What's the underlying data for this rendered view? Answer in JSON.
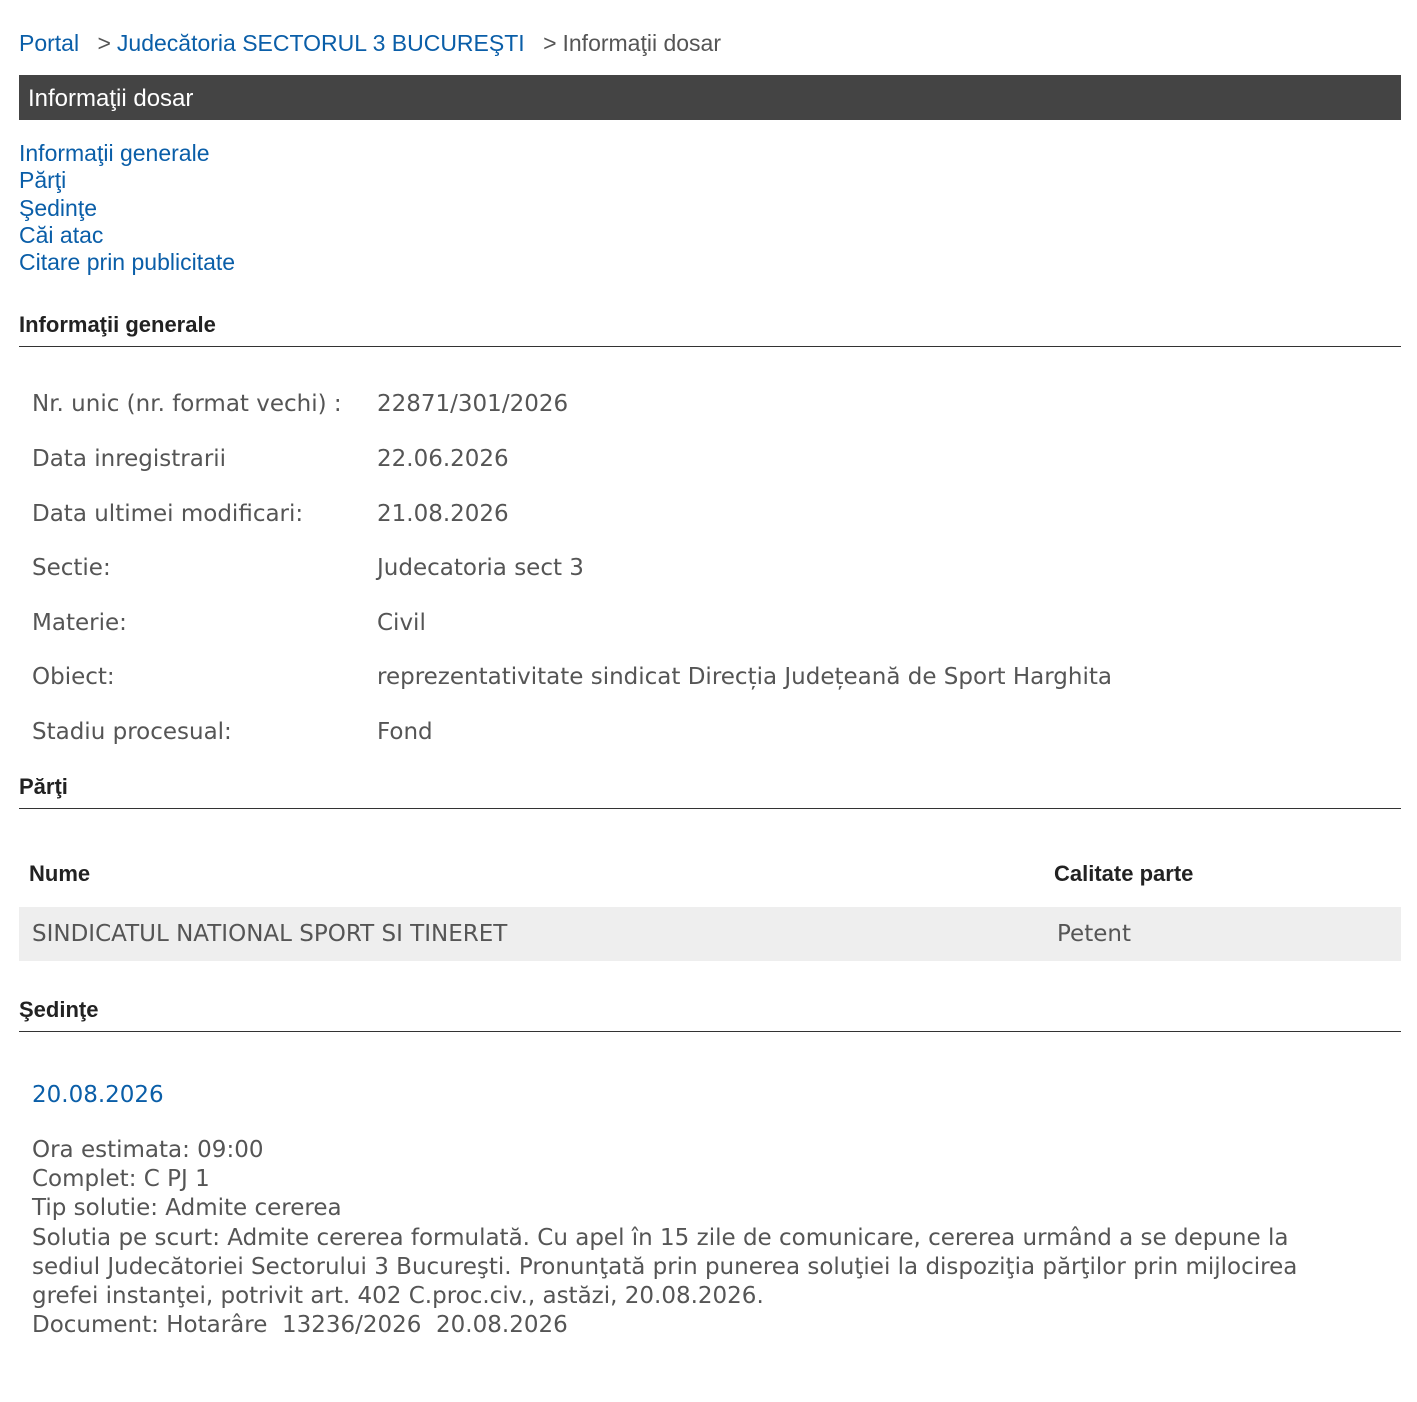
{
  "breadcrumb": {
    "portal": "Portal",
    "court": "Judecătoria SECTORUL 3 BUCUREŞTI",
    "current": "Informaţii dosar",
    "separator": ">"
  },
  "title": "Informaţii dosar",
  "toc": [
    "Informaţii generale",
    "Părţi",
    "Şedinţe",
    "Căi atac",
    "Citare prin publicitate"
  ],
  "general": {
    "heading": "Informaţii generale",
    "rows": [
      {
        "label": "Nr. unic (nr. format vechi) :",
        "value": "22871/301/2026"
      },
      {
        "label": "Data inregistrarii",
        "value": "22.06.2026"
      },
      {
        "label": "Data ultimei modificari:",
        "value": "21.08.2026"
      },
      {
        "label": "Sectie:",
        "value": "Judecatoria sect 3"
      },
      {
        "label": "Materie:",
        "value": "Civil"
      },
      {
        "label": "Obiect:",
        "value": "reprezentativitate sindicat Direcția Județeană de Sport Harghita"
      },
      {
        "label": "Stadiu procesual:",
        "value": "Fond"
      }
    ]
  },
  "parti": {
    "heading": "Părţi",
    "col_name": "Nume",
    "col_role": "Calitate parte",
    "rows": [
      {
        "name": "SINDICATUL NATIONAL SPORT SI TINERET",
        "role": "Petent"
      }
    ]
  },
  "sedinte": {
    "heading": "Şedinţe",
    "date": "20.08.2026",
    "ora": "Ora estimata: 09:00",
    "complet": "Complet: C PJ 1",
    "tip": "Tip solutie: Admite cererea",
    "solutia": "Solutia pe scurt: Admite cererea formulată. Cu apel în 15 zile de comunicare, cererea urmând a se depune la sediul Judecătoriei Sectorului 3 Bucureşti. Pronunţată prin punerea soluţiei la dispoziţia părţilor prin mijlocirea grefei instanţei, potrivit art. 402 C.proc.civ., astăzi, 20.08.2026.",
    "document": "Document: Hotarâre  13236/2026  20.08.2026"
  }
}
